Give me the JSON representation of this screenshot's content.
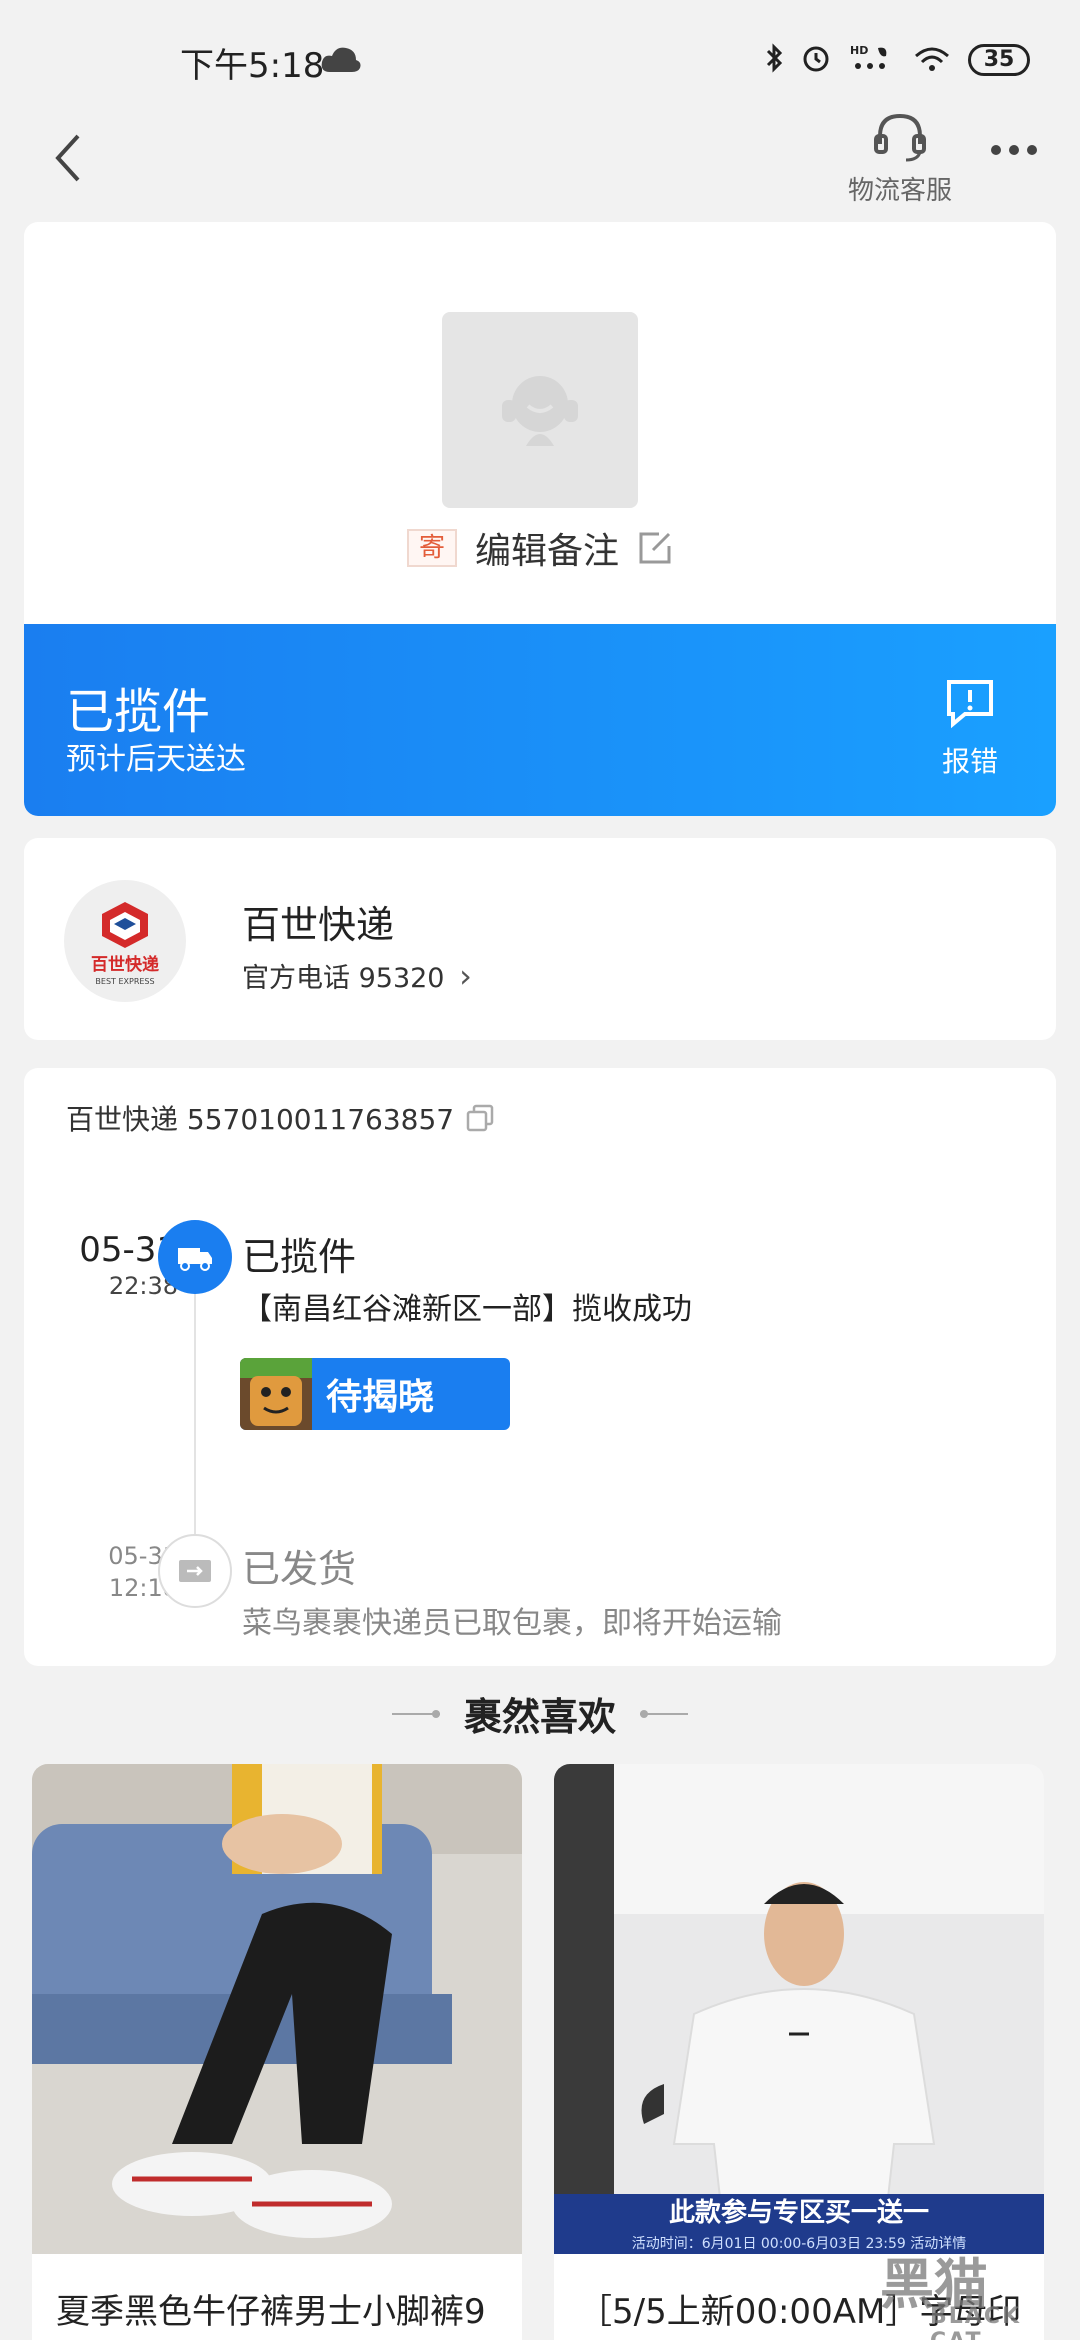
{
  "status_bar": {
    "time": "下午5:18",
    "battery": "35"
  },
  "nav": {
    "support_label": "物流客服"
  },
  "package": {
    "send_tag": "寄",
    "note": "编辑备注",
    "status": "已揽件",
    "eta": "预计后天送达",
    "report_label": "报错"
  },
  "courier": {
    "logo_cn": "百世快递",
    "logo_en": "BEST EXPRESS",
    "name": "百世快递",
    "phone": "官方电话 95320",
    "phone_chevron": "›"
  },
  "tracking": {
    "header": "百世快递 557010011763857",
    "events": [
      {
        "date": "05-31",
        "time": "22:38",
        "title": "已揽件",
        "desc": "【南昌红谷滩新区一部】揽收成功"
      },
      {
        "date": "05-31",
        "time": "12:18",
        "title": "已发货",
        "desc": "菜鸟裹裹快递员已取包裹，即将开始运输"
      }
    ],
    "reveal_label": "待揭晓"
  },
  "recommend": {
    "title": "裹然喜欢",
    "products": [
      {
        "name": "夏季黑色牛仔裤男士小脚裤9"
      },
      {
        "name": "［5/5上新00:00AM］字母印",
        "promo": "此款参与专区买一送一",
        "promo_sub": "活动时间：6月01日 00:00-6月03日 23:59 活动详情"
      }
    ]
  },
  "watermark": {
    "cn": "黑猫",
    "en": "BLACK CAT"
  },
  "colors": {
    "accent": "#1a7ef0",
    "tag_red": "#e35d3a"
  }
}
